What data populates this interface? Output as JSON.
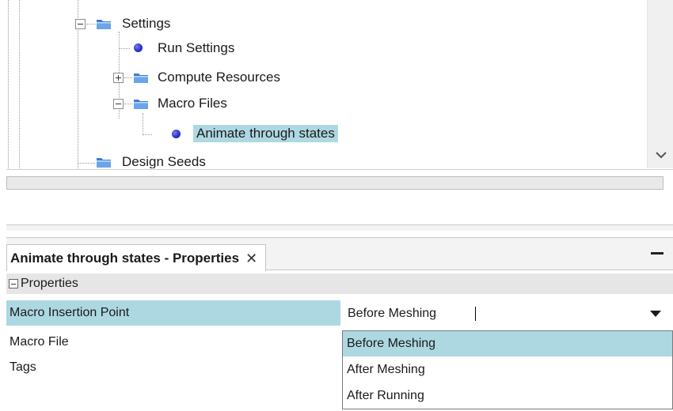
{
  "tree": {
    "nodes": [
      {
        "label": "Settings",
        "kind": "folder",
        "expander": "minus",
        "selected": false
      },
      {
        "label": "Run Settings",
        "kind": "item",
        "expander": "none",
        "selected": false
      },
      {
        "label": "Compute Resources",
        "kind": "folder",
        "expander": "plus",
        "selected": false
      },
      {
        "label": "Macro Files",
        "kind": "folder",
        "expander": "minus",
        "selected": false
      },
      {
        "label": "Animate through states",
        "kind": "item",
        "expander": "none",
        "selected": true
      },
      {
        "label": "Design Seeds",
        "kind": "folder",
        "expander": "none",
        "selected": false
      }
    ]
  },
  "properties_panel": {
    "tab_title": "Animate through states - Properties",
    "tab_close_glyph": "✕",
    "section_label": "Properties",
    "rows": [
      {
        "name": "Macro Insertion Point",
        "value": "Before Meshing"
      },
      {
        "name": "Macro File",
        "value": ""
      },
      {
        "name": "Tags",
        "value": ""
      }
    ],
    "dropdown": {
      "options": [
        "Before Meshing",
        "After Meshing",
        "After Running"
      ],
      "selected_index": 0
    }
  },
  "colors": {
    "selection": "#add8e2",
    "section_bg": "#e6e6e6",
    "tab_bar_bg": "#f3f3f3",
    "folder": "#3b7bd0",
    "node_dot": "#2d2fcf"
  }
}
